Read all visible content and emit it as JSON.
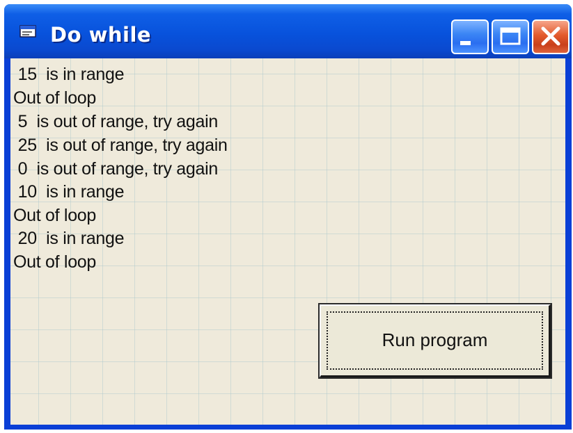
{
  "window": {
    "title": "Do while",
    "icon": "form-icon",
    "controls": {
      "minimize_icon": "minimize-icon",
      "maximize_icon": "maximize-icon",
      "close_icon": "close-icon"
    }
  },
  "output": [
    " 15  is in range",
    "Out of loop",
    " 5  is out of range, try again",
    " 25  is out of range, try again",
    " 0  is out of range, try again",
    " 10  is in range",
    "Out of loop",
    " 20  is in range",
    "Out of loop"
  ],
  "run_button": {
    "label": "Run program"
  },
  "colors": {
    "titlebar": "#0852dc",
    "client": "#efeadb",
    "close_button": "#e35a2c"
  }
}
